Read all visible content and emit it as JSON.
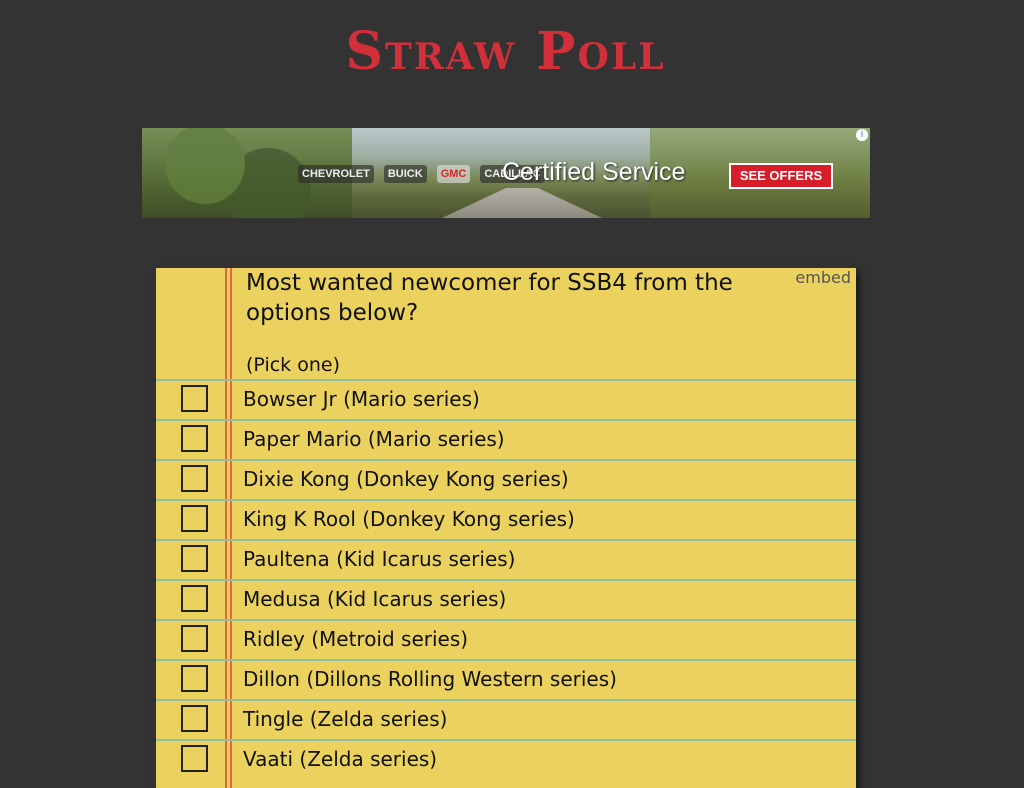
{
  "header": {
    "logo_text": "Straw Poll"
  },
  "ad": {
    "brands": [
      "CHEVROLET",
      "BUICK",
      "GMC",
      "CADILLAC"
    ],
    "headline": "Certified Service",
    "cta": "SEE OFFERS",
    "info_icon": "info-icon",
    "cta_color": "#d61e2a"
  },
  "poll": {
    "question": "Most wanted newcomer for SSB4 from the options below?",
    "embed_label": "embed",
    "instruction": "(Pick one)",
    "options": [
      "Bowser Jr (Mario series)",
      "Paper Mario (Mario series)",
      "Dixie Kong (Donkey Kong series)",
      "King K Rool (Donkey Kong series)",
      "Paultena (Kid Icarus series)",
      "Medusa (Kid Icarus series)",
      "Ridley (Metroid series)",
      "Dillon (Dillons Rolling Western series)",
      "Tingle (Zelda series)",
      "Vaati (Zelda series)"
    ]
  },
  "colors": {
    "background": "#333333",
    "logo": "#d12f3a",
    "paper": "#ebd25e",
    "rule_line": "#8dbfa0",
    "margin_line": "#e06a3a"
  }
}
